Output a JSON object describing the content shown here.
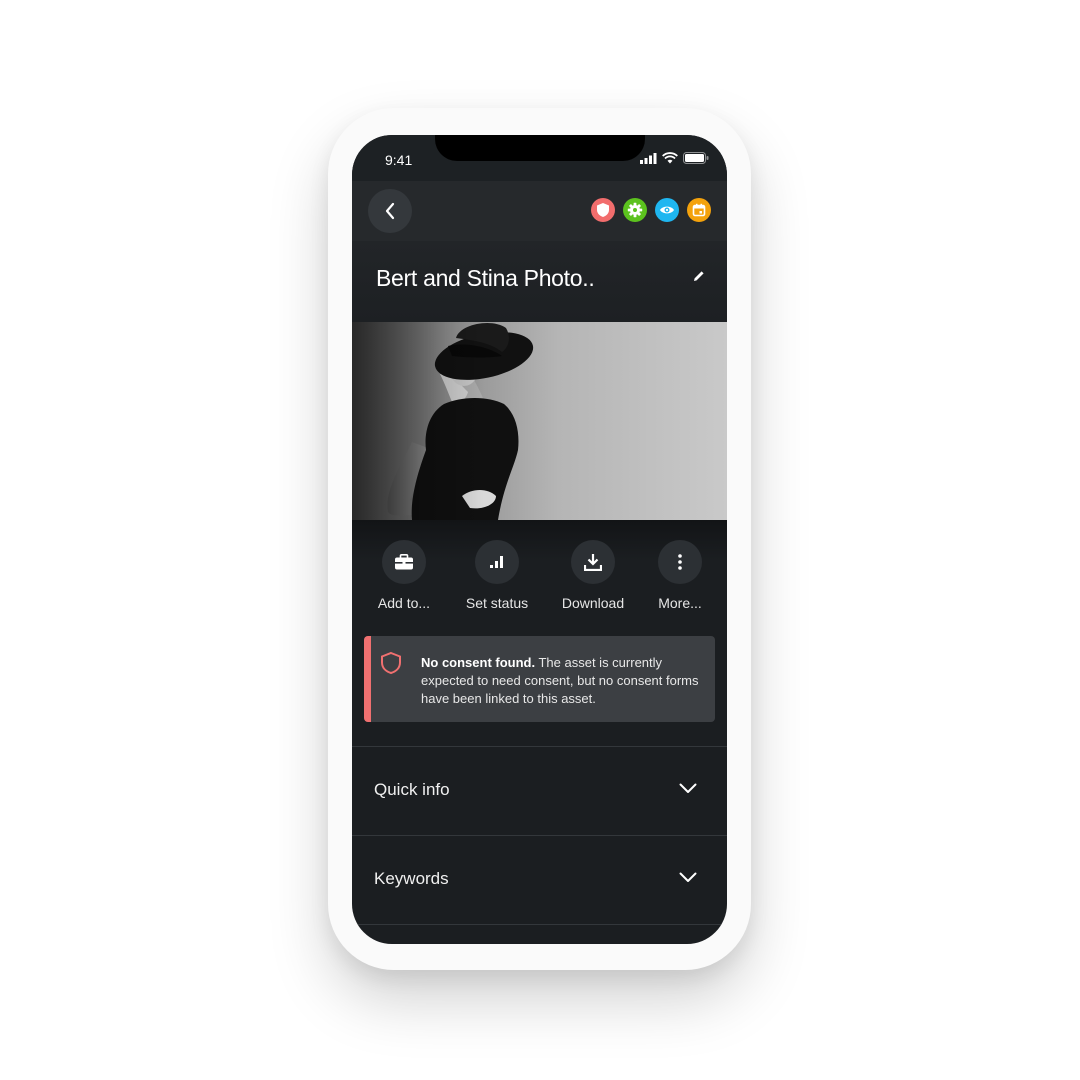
{
  "status_bar": {
    "time": "9:41"
  },
  "nav": {
    "badges": [
      {
        "name": "shield-badge",
        "color": "#f26d6d"
      },
      {
        "name": "gear-badge",
        "color": "#5cc21e"
      },
      {
        "name": "eye-badge",
        "color": "#1fb6f0"
      },
      {
        "name": "calendar-badge",
        "color": "#f4a20c"
      }
    ]
  },
  "asset": {
    "title": "Bert and Stina Photo.."
  },
  "actions": [
    {
      "label": "Add to...",
      "icon": "briefcase-icon"
    },
    {
      "label": "Set status",
      "icon": "bar-chart-icon"
    },
    {
      "label": "Download",
      "icon": "download-icon"
    },
    {
      "label": "More...",
      "icon": "more-vertical-icon"
    }
  ],
  "alert": {
    "title": "No consent found.",
    "message": " The asset is currently expected to need consent, but no consent forms have been linked to this asset.",
    "accent": "#f07070"
  },
  "sections": [
    {
      "label": "Quick info"
    },
    {
      "label": "Keywords"
    }
  ]
}
